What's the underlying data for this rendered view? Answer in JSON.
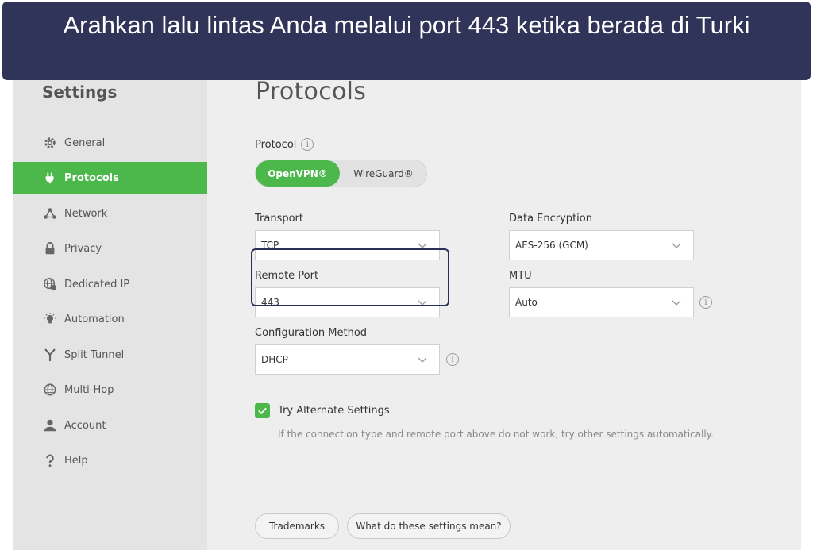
{
  "banner": {
    "text": "Arahkan lalu lintas Anda melalui port 443 ketika berada di Turki"
  },
  "sidebar": {
    "title": "Settings",
    "items": [
      {
        "label": "General",
        "icon": "gear-icon"
      },
      {
        "label": "Protocols",
        "icon": "plug-icon"
      },
      {
        "label": "Network",
        "icon": "network-icon"
      },
      {
        "label": "Privacy",
        "icon": "lock-icon"
      },
      {
        "label": "Dedicated IP",
        "icon": "globe-ip-icon"
      },
      {
        "label": "Automation",
        "icon": "lightbulb-icon"
      },
      {
        "label": "Split Tunnel",
        "icon": "split-icon"
      },
      {
        "label": "Multi-Hop",
        "icon": "globe-icon"
      },
      {
        "label": "Account",
        "icon": "user-icon"
      },
      {
        "label": "Help",
        "icon": "question-icon"
      }
    ],
    "active": "Protocols"
  },
  "main": {
    "title": "Protocols",
    "protocol": {
      "label": "Protocol",
      "options": [
        "OpenVPN®",
        "WireGuard®"
      ],
      "selected": "OpenVPN®"
    },
    "transport": {
      "label": "Transport",
      "value": "TCP"
    },
    "data_encryption": {
      "label": "Data Encryption",
      "value": "AES-256 (GCM)"
    },
    "remote_port": {
      "label": "Remote Port",
      "value": "443"
    },
    "mtu": {
      "label": "MTU",
      "value": "Auto"
    },
    "config_method": {
      "label": "Configuration Method",
      "value": "DHCP"
    },
    "alternate": {
      "label": "Try Alternate Settings",
      "checked": true,
      "description": "If the connection type and remote port above do not work, try other settings automatically."
    },
    "buttons": {
      "trademarks": "Trademarks",
      "settings_help": "What do these settings mean?"
    }
  },
  "colors": {
    "accent": "#4cb84c",
    "banner": "#2f3458",
    "highlight": "#2a2f55"
  }
}
